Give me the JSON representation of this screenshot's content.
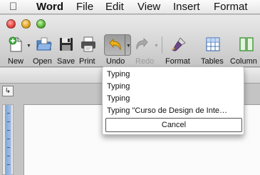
{
  "menubar": {
    "app_name": "Word",
    "items": [
      "File",
      "Edit",
      "View",
      "Insert",
      "Format"
    ]
  },
  "toolbar": {
    "buttons": [
      {
        "label": "New",
        "icon": "new-document-icon"
      },
      {
        "label": "Open",
        "icon": "open-folder-icon"
      },
      {
        "label": "Save",
        "icon": "save-disk-icon"
      },
      {
        "label": "Print",
        "icon": "printer-icon"
      },
      {
        "label": "Undo",
        "icon": "undo-icon"
      },
      {
        "label": "Redo",
        "icon": "redo-icon",
        "disabled": true
      },
      {
        "label": "Format",
        "icon": "format-brush-icon"
      },
      {
        "label": "Tables",
        "icon": "table-grid-icon"
      },
      {
        "label": "Column",
        "icon": "columns-icon"
      }
    ]
  },
  "undo_dropdown": {
    "items": [
      "Typing",
      "Typing",
      "Typing",
      "Typing \"Curso de Design de Inte…"
    ],
    "cancel_label": "Cancel"
  },
  "colors": {
    "undo_icon": "#f0b21a",
    "redo_icon_disabled": "#a9a9a9",
    "new_doc_plus": "#3fb23c",
    "ruler_blue": "#7fa6d6"
  }
}
